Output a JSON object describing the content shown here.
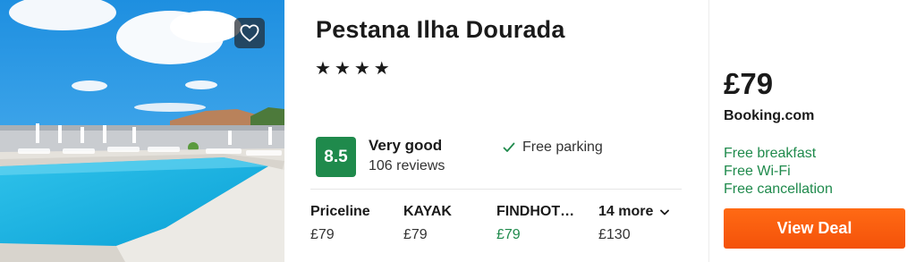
{
  "hotel": {
    "name": "Pestana Ilha Dourada",
    "stars_display": "★★★★",
    "star_count": 4,
    "rating_score": "8.5",
    "rating_word": "Very good",
    "review_count": "106 reviews",
    "amenity": "Free parking",
    "favorite_icon": "heart-icon"
  },
  "providers": [
    {
      "name": "Priceline",
      "price": "£79"
    },
    {
      "name": "KAYAK",
      "price": "£79"
    },
    {
      "name": "FINDHOT…",
      "price": "£79"
    }
  ],
  "more": {
    "label": "14 more",
    "price": "£130"
  },
  "deal": {
    "price": "£79",
    "site": "Booking.com",
    "perks": [
      "Free breakfast",
      "Free Wi-Fi",
      "Free cancellation"
    ],
    "button_label": "View Deal"
  },
  "colors": {
    "rating_green": "#1f8a4c",
    "deal_orange": "#f4520a",
    "perk_green": "#1f8a4c"
  }
}
